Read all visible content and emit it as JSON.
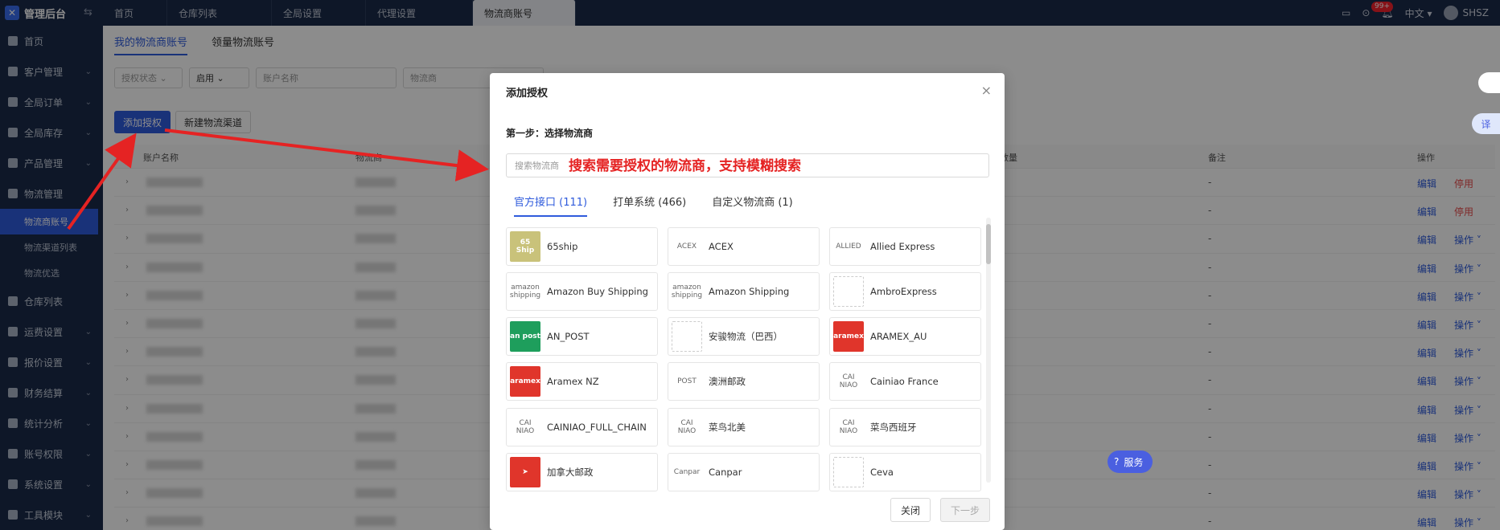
{
  "app": {
    "title": "管理后台"
  },
  "tabs": [
    {
      "label": "首页"
    },
    {
      "label": "仓库列表"
    },
    {
      "label": "全局设置"
    },
    {
      "label": "代理设置"
    },
    {
      "label": "物流商账号"
    }
  ],
  "topbar": {
    "lang": "中文",
    "user": "SHSZ",
    "badge": "99+"
  },
  "sidebar": {
    "items": [
      {
        "label": "首页"
      },
      {
        "label": "客户管理"
      },
      {
        "label": "全局订单"
      },
      {
        "label": "全局库存"
      },
      {
        "label": "产品管理"
      },
      {
        "label": "物流管理"
      },
      {
        "label": "仓库列表"
      },
      {
        "label": "运费设置"
      },
      {
        "label": "报价设置"
      },
      {
        "label": "财务结算"
      },
      {
        "label": "统计分析"
      },
      {
        "label": "账号权限"
      },
      {
        "label": "系统设置"
      },
      {
        "label": "工具模块"
      }
    ],
    "subitems": [
      {
        "label": "物流商账号"
      },
      {
        "label": "物流渠道列表"
      },
      {
        "label": "物流优选"
      }
    ]
  },
  "page": {
    "subtabs": [
      {
        "label": "我的物流商账号"
      },
      {
        "label": "领量物流账号"
      }
    ],
    "filters": {
      "auth_status": "授权状态",
      "enabled": "启用",
      "account_name": "账户名称",
      "carrier": "物流商"
    },
    "buttons": {
      "add_auth": "添加授权",
      "new_channel": "新建物流渠道"
    },
    "columns": {
      "account_name": "账户名称",
      "carrier": "物流商",
      "service_count": "务数量",
      "note": "备注",
      "ops": "操作"
    },
    "rows": [
      {
        "note": "-",
        "edit": "编辑",
        "op": "停用"
      },
      {
        "note": "-",
        "edit": "编辑",
        "op": "停用"
      },
      {
        "note": "-",
        "edit": "编辑",
        "op": "操作 ˅"
      },
      {
        "note": "-",
        "edit": "编辑",
        "op": "操作 ˅"
      },
      {
        "note": "-",
        "edit": "编辑",
        "op": "操作 ˅"
      },
      {
        "note": "-",
        "edit": "编辑",
        "op": "操作 ˅"
      },
      {
        "note": "-",
        "edit": "编辑",
        "op": "操作 ˅"
      },
      {
        "note": "-",
        "edit": "编辑",
        "op": "操作 ˅"
      },
      {
        "note": "-",
        "edit": "编辑",
        "op": "操作 ˅"
      },
      {
        "note": "-",
        "edit": "编辑",
        "op": "操作 ˅"
      },
      {
        "note": "-",
        "edit": "编辑",
        "op": "操作 ˅"
      },
      {
        "note": "-",
        "edit": "编辑",
        "op": "操作 ˅"
      },
      {
        "note": "-",
        "edit": "编辑",
        "op": "操作 ˅"
      }
    ]
  },
  "modal": {
    "title": "添加授权",
    "step": "第一步：选择物流商",
    "search_placeholder": "搜索物流商",
    "annotation": "搜索需要授权的物流商，支持模糊搜索",
    "tabs": [
      {
        "label": "官方接口 (111)"
      },
      {
        "label": "打单系统 (466)"
      },
      {
        "label": "自定义物流商 (1)"
      }
    ],
    "carriers": [
      {
        "name": "65ship",
        "logo": "65 Ship",
        "color": "#c9c27a"
      },
      {
        "name": "ACEX",
        "logo": "ACEX",
        "color": "#ffffff"
      },
      {
        "name": "Allied Express",
        "logo": "ALLIED",
        "color": "#ffffff"
      },
      {
        "name": "Amazon Buy Shipping",
        "logo": "amazon shipping",
        "color": "#ffffff"
      },
      {
        "name": "Amazon Shipping",
        "logo": "amazon shipping",
        "color": "#ffffff"
      },
      {
        "name": "AmbroExpress",
        "logo": "",
        "color": "#ffffff"
      },
      {
        "name": "AN_POST",
        "logo": "an post",
        "color": "#1e9e5c"
      },
      {
        "name": "安骏物流（巴西）",
        "logo": "",
        "color": "#ffffff"
      },
      {
        "name": "ARAMEX_AU",
        "logo": "aramex",
        "color": "#e0352b"
      },
      {
        "name": "Aramex NZ",
        "logo": "aramex",
        "color": "#e0352b"
      },
      {
        "name": "澳洲邮政",
        "logo": "POST",
        "color": "#ffffff"
      },
      {
        "name": "Cainiao France",
        "logo": "CAI NIAO",
        "color": "#ffffff"
      },
      {
        "name": "CAINIAO_FULL_CHAIN",
        "logo": "CAI NIAO",
        "color": "#ffffff"
      },
      {
        "name": "菜鸟北美",
        "logo": "CAI NIAO",
        "color": "#ffffff"
      },
      {
        "name": "菜鸟西班牙",
        "logo": "CAI NIAO",
        "color": "#ffffff"
      },
      {
        "name": "加拿大邮政",
        "logo": "➤",
        "color": "#e0352b"
      },
      {
        "name": "Canpar",
        "logo": "Canpar",
        "color": "#ffffff"
      },
      {
        "name": "Ceva",
        "logo": "",
        "color": "#ffffff"
      }
    ],
    "buttons": {
      "close": "关闭",
      "next": "下一步"
    }
  },
  "service_button": "服务",
  "translate_button": "译"
}
